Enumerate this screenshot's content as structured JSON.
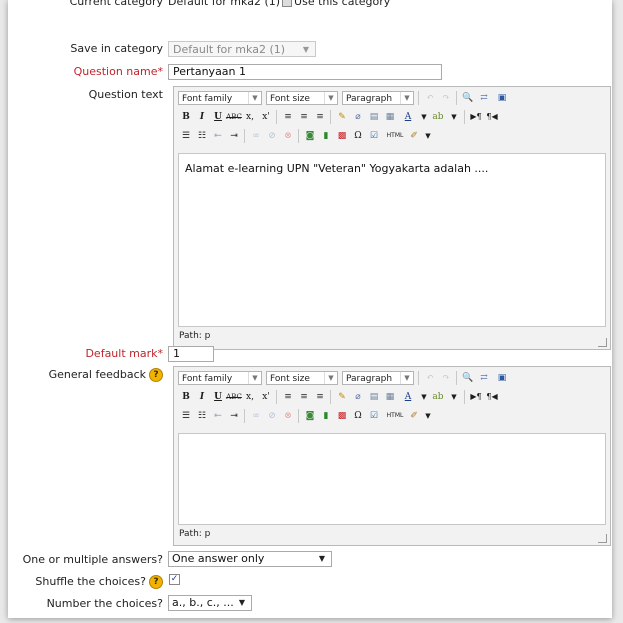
{
  "current_category": {
    "label": "Current category",
    "value": "Default for mka2 (1)",
    "use_label": "Use this category"
  },
  "save_in_category": {
    "label": "Save in category",
    "value": "Default for mka2 (1)"
  },
  "question_name": {
    "label": "Question name",
    "required_mark": "*",
    "value": "Pertanyaan 1"
  },
  "question_text": {
    "label": "Question text",
    "content": "Alamat e-learning UPN \"Veteran\" Yogyakarta adalah ....",
    "path": "Path: p"
  },
  "editor_toolbar": {
    "font_family": "Font family",
    "font_size": "Font size",
    "format": "Paragraph",
    "bold": "B",
    "italic": "I",
    "underline": "U",
    "strike": "ABC",
    "subscript": "x,",
    "superscript": "x'",
    "text_color": "A",
    "html": "HTML"
  },
  "default_mark": {
    "label": "Default mark",
    "required_mark": "*",
    "value": "1"
  },
  "general_feedback": {
    "label": "General feedback",
    "content": "",
    "path": "Path: p"
  },
  "one_or_multiple": {
    "label": "One or multiple answers?",
    "value": "One answer only"
  },
  "shuffle_choices": {
    "label": "Shuffle the choices?",
    "checked": true,
    "check_glyph": "✓"
  },
  "number_choices": {
    "label": "Number the choices?",
    "value": "a., b., c., ..."
  },
  "help_glyph": "?",
  "arrow_glyph": "▼",
  "colors": {
    "required": "#c0242b",
    "help": "#f0b400"
  }
}
